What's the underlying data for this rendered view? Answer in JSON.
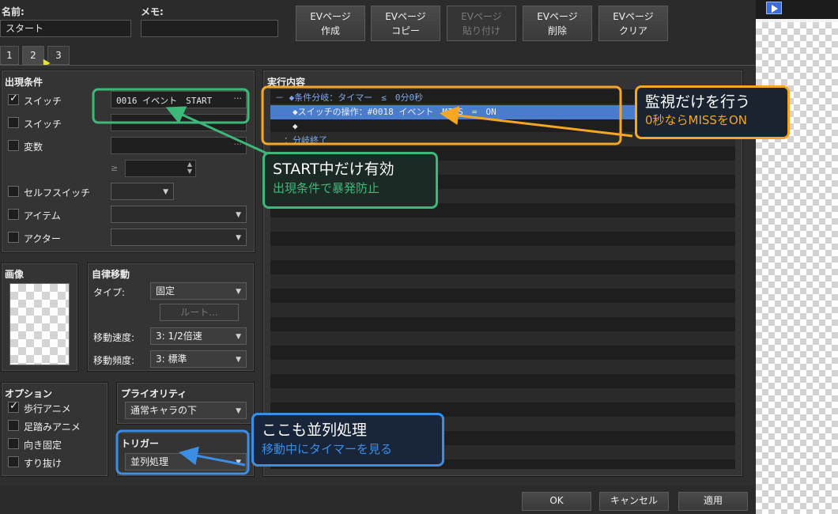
{
  "header": {
    "name_label": "名前:",
    "name_value": "スタート",
    "memo_label": "メモ:",
    "memo_value": ""
  },
  "toolbar": {
    "buttons": [
      {
        "line1": "EVページ",
        "line2": "作成",
        "enabled": true
      },
      {
        "line1": "EVページ",
        "line2": "コピー",
        "enabled": true
      },
      {
        "line1": "EVページ",
        "line2": "貼り付け",
        "enabled": false
      },
      {
        "line1": "EVページ",
        "line2": "削除",
        "enabled": true
      },
      {
        "line1": "EVページ",
        "line2": "クリア",
        "enabled": true
      }
    ]
  },
  "page_tabs": [
    "1",
    "2",
    "3"
  ],
  "active_tab": "2",
  "conditions": {
    "title": "出現条件",
    "switch1_label": "スイッチ",
    "switch1_checked": true,
    "switch1_value": "0016 イベント　START",
    "switch1_more": "···",
    "switch2_label": "スイッチ",
    "switch2_checked": false,
    "variable_label": "変数",
    "variable_checked": false,
    "variable_more": "···",
    "compare_symbol": "≥",
    "selfswitch_label": "セルフスイッチ",
    "selfswitch_checked": false,
    "item_label": "アイテム",
    "item_checked": false,
    "actor_label": "アクター",
    "actor_checked": false
  },
  "image_panel": {
    "title": "画像"
  },
  "auto_move": {
    "title": "自律移動",
    "type_label": "タイプ:",
    "type_value": "固定",
    "route_button": "ルート...",
    "speed_label": "移動速度:",
    "speed_value": "3: 1/2倍速",
    "freq_label": "移動頻度:",
    "freq_value": "3: 標準"
  },
  "options": {
    "title": "オプション",
    "items": [
      {
        "label": "歩行アニメ",
        "checked": true
      },
      {
        "label": "足踏みアニメ",
        "checked": false
      },
      {
        "label": "向き固定",
        "checked": false
      },
      {
        "label": "すり抜け",
        "checked": false
      }
    ]
  },
  "priority": {
    "title": "プライオリティ",
    "value": "通常キャラの下"
  },
  "trigger": {
    "title": "トリガー",
    "value": "並列処理"
  },
  "contents": {
    "title": "実行内容",
    "rows": [
      {
        "text": "－ ◆条件分岐：タイマー　≤　0分0秒",
        "selected": false,
        "white": false
      },
      {
        "text": "　　◆スイッチの操作：#0018 イベント　MISS　=　ON",
        "selected": true,
        "white": false
      },
      {
        "text": "　　◆",
        "selected": false,
        "white": true
      },
      {
        "text": "　：分岐終了",
        "selected": false,
        "white": false
      },
      {
        "text": "◆",
        "selected": false,
        "white": true
      }
    ]
  },
  "callouts": {
    "orange_main": "監視だけを行う",
    "orange_sub": "0秒ならMISSをON",
    "green_main": "START中だけ有効",
    "green_sub": "出現条件で暴発防止",
    "blue_main": "ここも並列処理",
    "blue_sub": "移動中にタイマーを見る"
  },
  "colors": {
    "orange": "#f5a623",
    "green": "#3cb878",
    "blue": "#3a8ee6"
  },
  "footer": {
    "ok": "OK",
    "cancel": "キャンセル",
    "apply": "適用"
  }
}
